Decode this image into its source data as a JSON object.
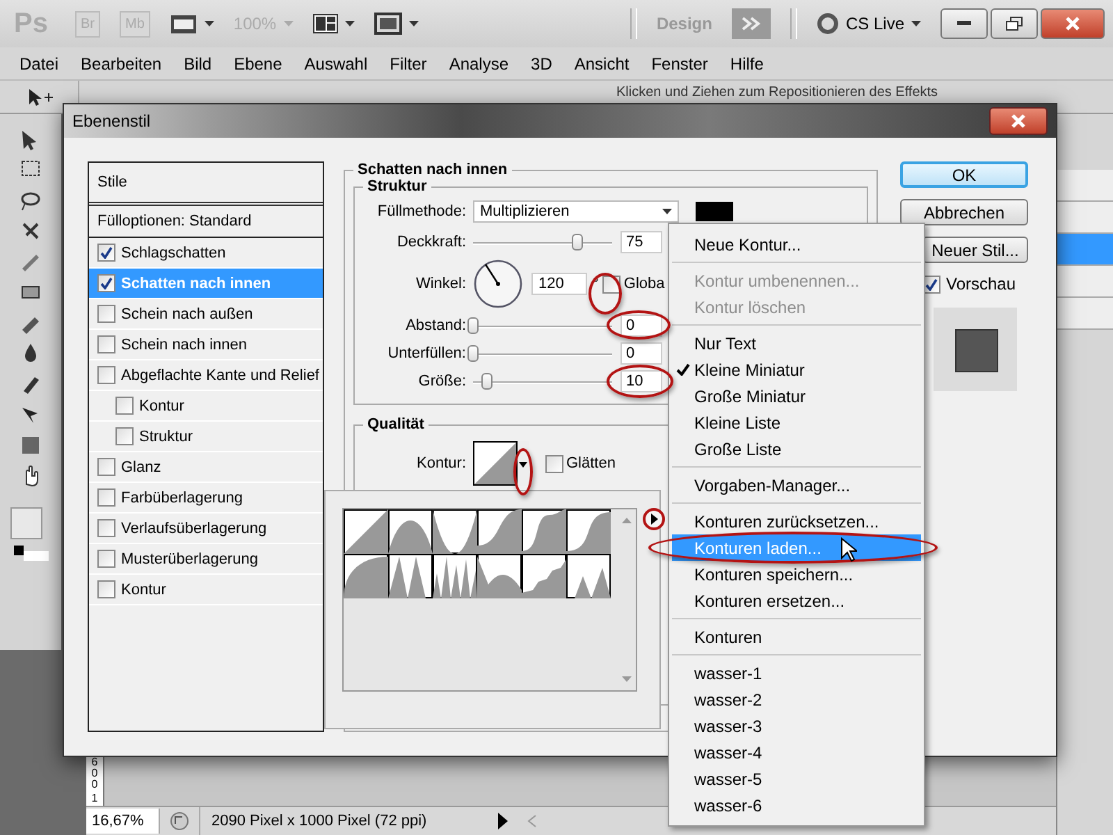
{
  "app_bar": {
    "logo": "Ps",
    "apps": [
      {
        "label": "Br"
      },
      {
        "label": "Mb"
      }
    ],
    "zoom": "100%",
    "workspace": "Design",
    "cs_live": "CS Live"
  },
  "menu_bar": [
    "Datei",
    "Bearbeiten",
    "Bild",
    "Ebene",
    "Auswahl",
    "Filter",
    "Analyse",
    "3D",
    "Ansicht",
    "Fenster",
    "Hilfe"
  ],
  "options_bar": {
    "hint": "Klicken und Ziehen zum Repositionieren des Effekts"
  },
  "dialog": {
    "title": "Ebenenstil",
    "styles_header": "Stile",
    "blend_options": "Fülloptionen: Standard",
    "styles": [
      {
        "label": "Schlagschatten",
        "checked": true,
        "selected": false
      },
      {
        "label": "Schatten nach innen",
        "checked": true,
        "selected": true
      },
      {
        "label": "Schein nach außen",
        "checked": false,
        "selected": false
      },
      {
        "label": "Schein nach innen",
        "checked": false,
        "selected": false
      },
      {
        "label": "Abgeflachte Kante und Relief",
        "checked": false,
        "selected": false,
        "children": [
          {
            "label": "Kontur",
            "checked": false,
            "selected": false
          },
          {
            "label": "Struktur",
            "checked": false,
            "selected": false
          }
        ]
      },
      {
        "label": "Glanz",
        "checked": false,
        "selected": false
      },
      {
        "label": "Farbüberlagerung",
        "checked": false,
        "selected": false
      },
      {
        "label": "Verlaufsüberlagerung",
        "checked": false,
        "selected": false
      },
      {
        "label": "Musterüberlagerung",
        "checked": false,
        "selected": false
      },
      {
        "label": "Kontur",
        "checked": false,
        "selected": false
      }
    ],
    "section_title": "Schatten nach innen",
    "structure": {
      "title": "Struktur",
      "blend_mode": {
        "label": "Füllmethode:",
        "value": "Multiplizieren",
        "color": "#000000"
      },
      "rows": [
        {
          "kind": "slider",
          "label": "Deckkraft:",
          "level": 0.75,
          "value": "75"
        },
        {
          "kind": "angle",
          "label": "Winkel:",
          "value": "120",
          "unit": "°",
          "global": {
            "label": "Globa",
            "checked": false
          }
        },
        {
          "kind": "slider",
          "label": "Abstand:",
          "level": 0,
          "value": "0"
        },
        {
          "kind": "slider",
          "label": "Unterfüllen:",
          "level": 0,
          "value": "0"
        },
        {
          "kind": "slider",
          "label": "Größe:",
          "level": 0.1,
          "value": "10"
        }
      ]
    },
    "quality": {
      "title": "Qualität",
      "contour_label": "Kontur:",
      "antialias": {
        "label": "Glätten",
        "checked": false
      }
    },
    "buttons": [
      {
        "label": "OK",
        "default": true
      },
      {
        "label": "Abbrechen",
        "default": false
      },
      {
        "label": "Neuer Stil...",
        "default": false
      }
    ],
    "preview": {
      "label": "Vorschau",
      "checked": true
    }
  },
  "context_menu": {
    "groups": [
      [
        {
          "label": "Neue Kontur...",
          "disabled": false,
          "checked": false,
          "selected": false
        }
      ],
      [
        {
          "label": "Kontur umbenennen...",
          "disabled": true,
          "checked": false,
          "selected": false
        },
        {
          "label": "Kontur löschen",
          "disabled": true,
          "checked": false,
          "selected": false
        }
      ],
      [
        {
          "label": "Nur Text",
          "disabled": false,
          "checked": false,
          "selected": false
        },
        {
          "label": "Kleine Miniatur",
          "disabled": false,
          "checked": true,
          "selected": false
        },
        {
          "label": "Große Miniatur",
          "disabled": false,
          "checked": false,
          "selected": false
        },
        {
          "label": "Kleine Liste",
          "disabled": false,
          "checked": false,
          "selected": false
        },
        {
          "label": "Große Liste",
          "disabled": false,
          "checked": false,
          "selected": false
        }
      ],
      [
        {
          "label": "Vorgaben-Manager...",
          "disabled": false,
          "checked": false,
          "selected": false
        }
      ],
      [
        {
          "label": "Konturen zurücksetzen...",
          "disabled": false,
          "checked": false,
          "selected": false
        },
        {
          "label": "Konturen laden...",
          "disabled": false,
          "checked": false,
          "selected": true
        },
        {
          "label": "Konturen speichern...",
          "disabled": false,
          "checked": false,
          "selected": false
        },
        {
          "label": "Konturen ersetzen...",
          "disabled": false,
          "checked": false,
          "selected": false
        }
      ],
      [
        {
          "label": "Konturen",
          "disabled": false,
          "checked": false,
          "selected": false
        }
      ],
      [
        {
          "label": "wasser-1",
          "disabled": false,
          "checked": false,
          "selected": false
        },
        {
          "label": "wasser-2",
          "disabled": false,
          "checked": false,
          "selected": false
        },
        {
          "label": "wasser-3",
          "disabled": false,
          "checked": false,
          "selected": false
        },
        {
          "label": "wasser-4",
          "disabled": false,
          "checked": false,
          "selected": false
        },
        {
          "label": "wasser-5",
          "disabled": false,
          "checked": false,
          "selected": false
        },
        {
          "label": "wasser-6",
          "disabled": false,
          "checked": false,
          "selected": false
        }
      ]
    ]
  },
  "ruler_labels": [
    "600",
    "1"
  ],
  "status_bar": {
    "zoom": "16,67%",
    "doc_info": "2090 Pixel x 1000 Pixel (72 ppi)"
  }
}
